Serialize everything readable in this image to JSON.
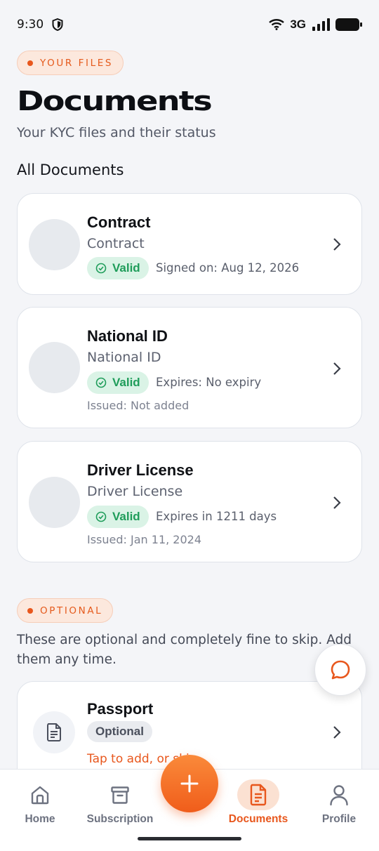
{
  "status_bar": {
    "time": "9:30",
    "network": "3G"
  },
  "header": {
    "tag": "YOUR FILES",
    "title": "Documents",
    "subtitle": "Your KYC files and their status",
    "section": "All Documents"
  },
  "documents": [
    {
      "title": "Contract",
      "subtitle": "Contract",
      "status": "Valid",
      "meta": "Signed on: Aug 12, 2026",
      "extra": ""
    },
    {
      "title": "National ID",
      "subtitle": "National ID",
      "status": "Valid",
      "meta": "Expires: No expiry",
      "extra": "Issued: Not added"
    },
    {
      "title": "Driver License",
      "subtitle": "Driver License",
      "status": "Valid",
      "meta": "Expires in 1211 days",
      "extra": "Issued: Jan 11, 2024"
    }
  ],
  "optional": {
    "tag": "OPTIONAL",
    "description": "These are optional and completely fine to skip. Add them any time.",
    "item": {
      "title": "Passport",
      "badge": "Optional",
      "action": "Tap to add, or skip"
    }
  },
  "nav": {
    "items": [
      {
        "label": "Home",
        "icon": "home-icon"
      },
      {
        "label": "Subscription",
        "icon": "archive-icon"
      },
      {
        "label": "Documents",
        "icon": "document-icon",
        "active": true
      },
      {
        "label": "Profile",
        "icon": "profile-icon"
      }
    ]
  },
  "colors": {
    "accent": "#e8571d",
    "valid": "#1f9d5a",
    "background": "#f4f5f8"
  }
}
